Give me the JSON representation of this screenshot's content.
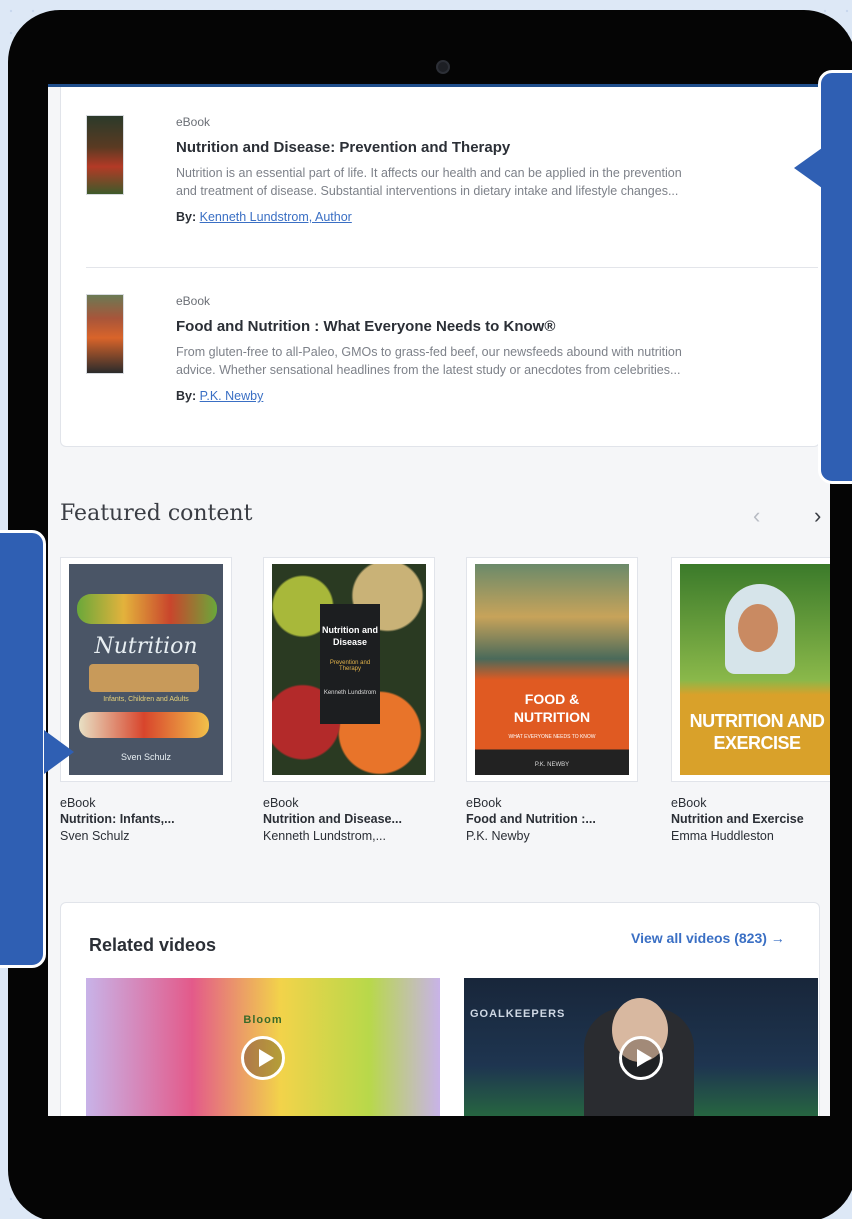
{
  "results": [
    {
      "type": "eBook",
      "title": "Nutrition and Disease: Prevention and Therapy",
      "description_line1": "Nutrition is an essential part of life. It affects our health and can be applied in the prevention",
      "description_line2": "and treatment of disease. Substantial interventions in dietary intake and lifestyle changes...",
      "by_label": "By:",
      "author": "Kenneth Lundstrom, Author"
    },
    {
      "type": "eBook",
      "title": "Food and Nutrition : What Everyone Needs to Know®",
      "description_line1": "From gluten-free to all-Paleo, GMOs to grass-fed beef, our newsfeeds abound with nutrition",
      "description_line2": "advice. Whether sensational headlines from the latest study or anecdotes from celebrities...",
      "by_label": "By:",
      "author": "P.K. Newby"
    }
  ],
  "featured": {
    "title": "Featured content",
    "prev_icon": "‹",
    "next_icon": "›",
    "books": [
      {
        "type": "eBook",
        "name": "Nutrition: Infants,...",
        "author": "Sven Schulz",
        "cover_title": "Nutrition",
        "cover_sub": "Infants, Children and Adults",
        "cover_author": "Sven Schulz"
      },
      {
        "type": "eBook",
        "name": "Nutrition and Disease...",
        "author": "Kenneth Lundstrom,...",
        "cover_title": "Nutrition and Disease",
        "cover_sub": "Prevention and Therapy",
        "cover_author": "Kenneth Lundstrom"
      },
      {
        "type": "eBook",
        "name": "Food and Nutrition :...",
        "author": "P.K. Newby",
        "cover_title": "FOOD & NUTRITION",
        "cover_sub": "WHAT EVERYONE NEEDS TO KNOW",
        "cover_author": "P.K. NEWBY"
      },
      {
        "type": "eBook",
        "name": "Nutrition and Exercise",
        "author": "Emma Huddleston",
        "cover_title": "NUTRITION AND EXERCISE",
        "cover_sub": "",
        "cover_author": ""
      }
    ]
  },
  "videos": {
    "title": "Related videos",
    "view_all": "View all videos (823) →",
    "items": [
      {
        "label": "Bloom"
      },
      {
        "label": "GOALKEEPERS"
      }
    ]
  }
}
